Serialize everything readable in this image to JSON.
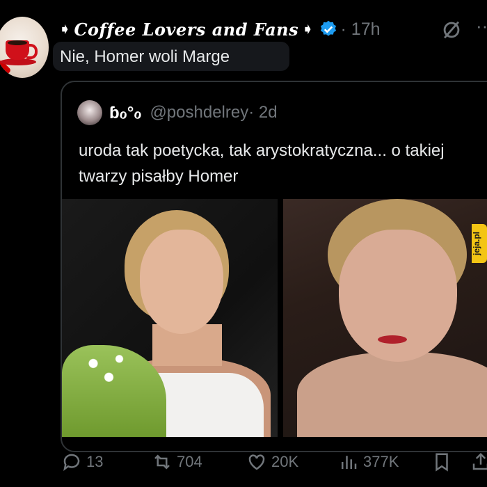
{
  "post": {
    "author_prefix": "➧",
    "author_name": "Coffee Lovers and Fans",
    "author_suffix": "➧",
    "time": "· 17h",
    "more": "··",
    "text": "Nie, Homer woli Marge"
  },
  "quoted": {
    "display_name": "ɓℴ°ℴ",
    "handle": "@poshdelrey",
    "time": "· 2d",
    "text": "uroda tak poetycka, tak arystokratyczna... o takiej twarzy pisałby Homer"
  },
  "actions": {
    "replies": "13",
    "reposts": "704",
    "likes": "20K",
    "views": "377K"
  },
  "watermark": "jeja.pl",
  "colors": {
    "background": "#000000",
    "text": "#e7e9ea",
    "muted": "#71767b",
    "verified": "#1d9bf0"
  },
  "icons": [
    "grok-icon",
    "verified-icon",
    "reply-icon",
    "repost-icon",
    "like-icon",
    "views-icon",
    "bookmark-icon",
    "share-icon"
  ]
}
